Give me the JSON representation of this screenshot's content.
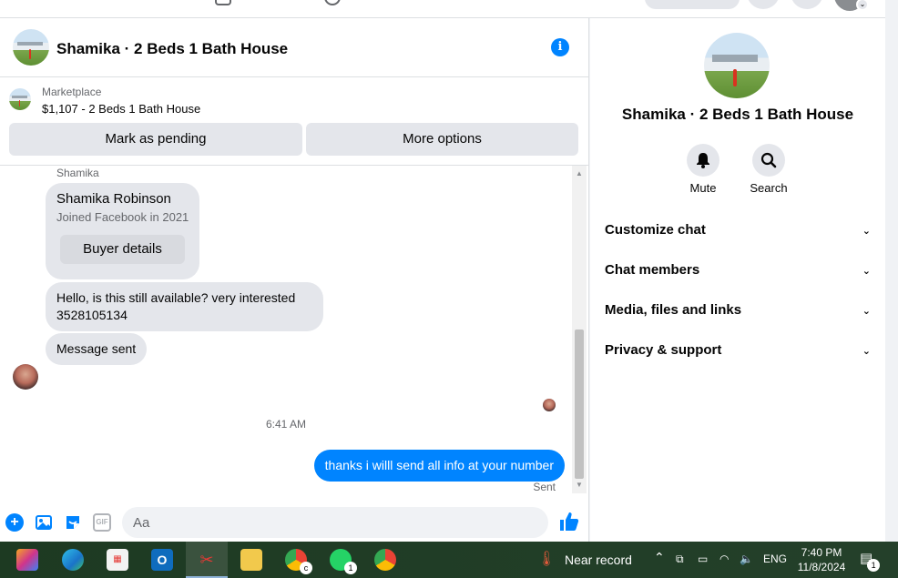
{
  "chat_header": {
    "title": "Shamika · 2 Beds 1 Bath House",
    "info_icon": "info-icon"
  },
  "marketplace": {
    "label": "Marketplace",
    "listing": "$1,107 - 2 Beds 1 Bath House",
    "mark_pending": "Mark as pending",
    "more_options": "More options"
  },
  "messages": {
    "sender_label": "Shamika",
    "buyer_card": {
      "name": "Shamika Robinson",
      "joined": "Joined Facebook in 2021",
      "button": "Buyer details"
    },
    "incoming": [
      "Hello, is this still available? very interested 3528105134",
      "Message sent"
    ],
    "timestamp": "6:41 AM",
    "outgoing": "thanks i willl send all info at your number",
    "status": "Sent"
  },
  "composer": {
    "placeholder": "Aa"
  },
  "details": {
    "title": "Shamika · 2 Beds 1 Bath House",
    "actions": [
      {
        "label": "Mute",
        "icon": "bell-icon"
      },
      {
        "label": "Search",
        "icon": "search-icon"
      }
    ],
    "sections": [
      "Customize chat",
      "Chat members",
      "Media, files and links",
      "Privacy & support"
    ]
  },
  "taskbar": {
    "weather": "Near record",
    "lang": "ENG",
    "time": "7:40 PM",
    "date": "11/8/2024",
    "whatsapp_badge": "1",
    "notification_badge": "1",
    "chrome_badge": "c"
  },
  "colors": {
    "accent": "#0084ff",
    "bubble_in": "#e4e6eb",
    "taskbar": "#1d3a22"
  }
}
